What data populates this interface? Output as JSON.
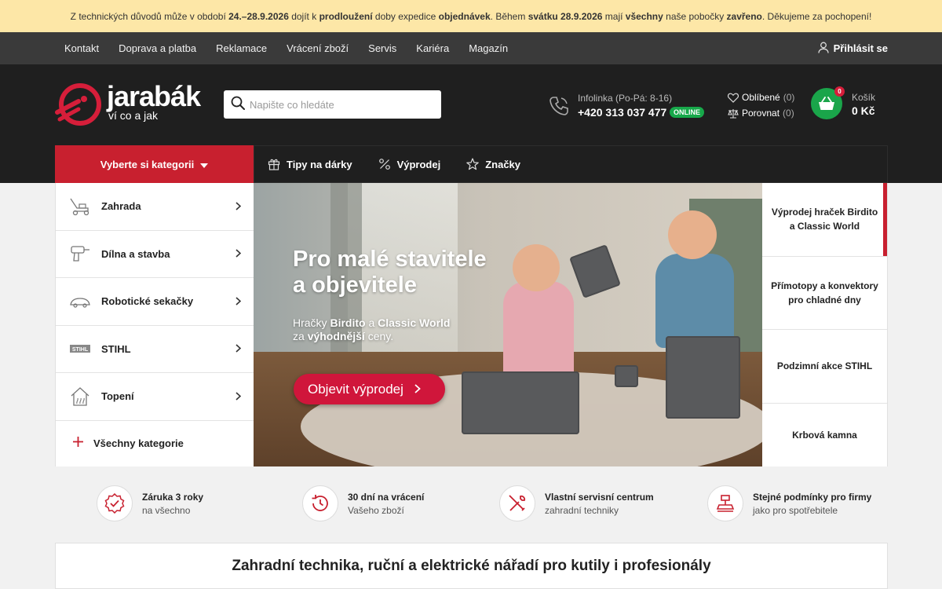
{
  "notice": {
    "p1": "Z technických důvodů může v období ",
    "b1": "24.–28.9.2026",
    "p2": " dojít k ",
    "b2": "prodloužení",
    "p3": " doby expedice ",
    "b3": "objednávek",
    "p4": ". Během ",
    "b4": "svátku 28.9.2026",
    "p5": " mají ",
    "b5": "všechny",
    "p6": " naše pobočky ",
    "b6": "zavřeno",
    "p7": ". Děkujeme za pochopení!"
  },
  "topnav": {
    "links": [
      "Kontakt",
      "Doprava a platba",
      "Reklamace",
      "Vrácení zboží",
      "Servis",
      "Kariéra",
      "Magazín"
    ],
    "login": "Přihlásit se"
  },
  "header": {
    "logo_wordmark": "jarabák",
    "logo_tagline": "ví co a jak",
    "search_placeholder": "Napište co hledáte",
    "infoline_label": "Infolinka (Po-Pá: 8-16)",
    "infoline_number": "+420 313 037 477",
    "online_badge": "ONLINE",
    "favorites_label": "Oblíbené",
    "favorites_count": "(0)",
    "compare_label": "Porovnat",
    "compare_count": "(0)",
    "cart_label": "Košík",
    "cart_price": "0 Kč",
    "cart_badge": "0"
  },
  "catbar": {
    "button": "Vyberte si kategorii",
    "items": [
      "Tipy na dárky",
      "Výprodej",
      "Značky"
    ]
  },
  "sidebar": {
    "items": [
      "Zahrada",
      "Dílna a stavba",
      "Robotické sekačky",
      "STIHL",
      "Topení"
    ],
    "all": "Všechny kategorie",
    "stihl_logo": "STIHL"
  },
  "hero": {
    "title1": "Pro malé stavitele",
    "title2": "a objevitele",
    "sub_p1": "Hračky ",
    "sub_b1": "Birdito",
    "sub_p2": " a ",
    "sub_b2": "Classic World",
    "sub_p3": "za ",
    "sub_b3": "výhodnější",
    "sub_p4": " ceny.",
    "cta": "Objevit výprodej"
  },
  "promos": [
    "Výprodej hraček Birdito a Classic World",
    "Přímotopy a konvektory pro chladné dny",
    "Podzimní akce STIHL",
    "Krbová kamna"
  ],
  "benefits": [
    {
      "title": "Záruka 3 roky",
      "sub": "na všechno"
    },
    {
      "title": "30 dní na vrácení",
      "sub": "Vašeho zboží"
    },
    {
      "title": "Vlastní servisní centrum",
      "sub": "zahradní techniky"
    },
    {
      "title": "Stejné podmínky pro firmy",
      "sub": "jako pro spotřebitele"
    }
  ],
  "bottom_heading": "Zahradní technika, ruční a elektrické nářadí pro kutily i profesionály",
  "colors": {
    "brand_red": "#c8202f",
    "cart_green": "#1aa54a",
    "notice_bg": "#fde7a7",
    "header_bg": "#1f1f1f"
  }
}
